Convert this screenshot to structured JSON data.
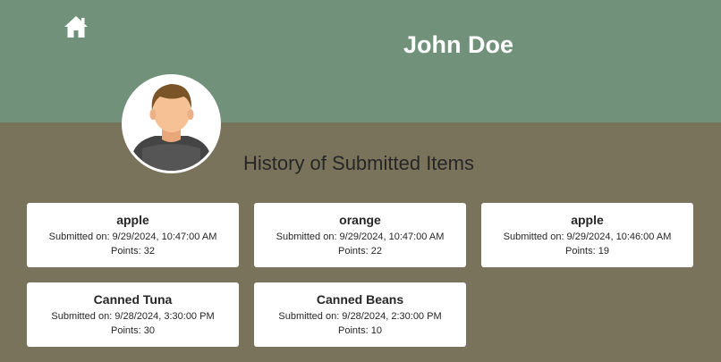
{
  "header": {
    "home_icon": "home-icon",
    "user_name": "John Doe",
    "avatar_icon": "user-avatar-icon"
  },
  "history": {
    "title": "History of Submitted Items",
    "submitted_prefix": "Submitted on: ",
    "points_prefix": "Points: ",
    "items": [
      {
        "name": "apple",
        "submitted": "Submitted on: 9/29/2024, 10:47:00 AM",
        "points": "Points: 32"
      },
      {
        "name": "orange",
        "submitted": "Submitted on: 9/29/2024, 10:47:00 AM",
        "points": "Points: 22"
      },
      {
        "name": "apple",
        "submitted": "Submitted on: 9/29/2024, 10:46:00 AM",
        "points": "Points: 19"
      },
      {
        "name": "Canned Tuna",
        "submitted": "Submitted on: 9/28/2024, 3:30:00 PM",
        "points": "Points: 30"
      },
      {
        "name": "Canned Beans",
        "submitted": "Submitted on: 9/28/2024, 2:30:00 PM",
        "points": "Points: 10"
      }
    ]
  },
  "colors": {
    "header_bg": "#71917a",
    "page_bg": "#7a735c",
    "card_bg": "#ffffff"
  }
}
